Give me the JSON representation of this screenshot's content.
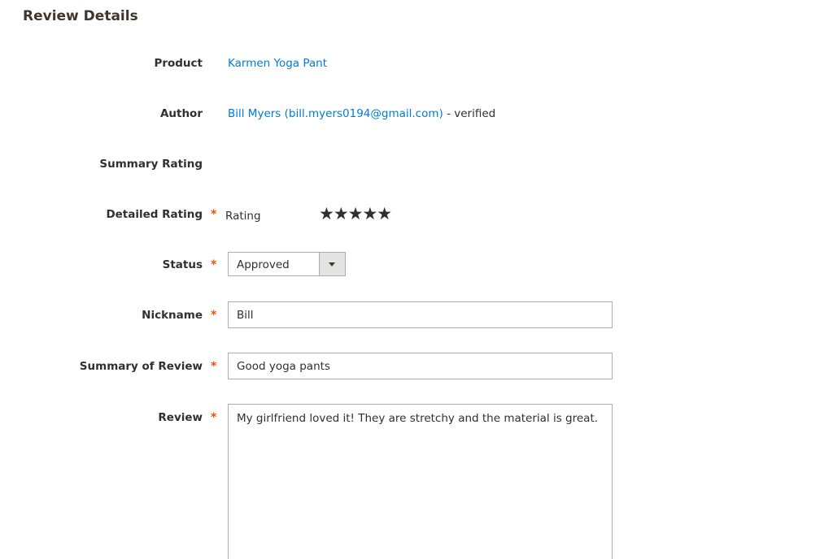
{
  "section": {
    "title": "Review Details"
  },
  "product": {
    "label": "Product",
    "value": "Karmen Yoga Pant"
  },
  "author": {
    "label": "Author",
    "name_link": "Bill Myers (bill.myers0194@gmail.com)",
    "suffix": " - verified"
  },
  "summary_rating": {
    "label": "Summary Rating"
  },
  "detailed_rating": {
    "label": "Detailed Rating",
    "required_mark": "*",
    "rating_label": "Rating",
    "stars": "★★★★★",
    "rating_value": 5,
    "rating_max": 5
  },
  "status": {
    "label": "Status",
    "required_mark": "*",
    "selected": "Approved"
  },
  "nickname": {
    "label": "Nickname",
    "required_mark": "*",
    "value": "Bill"
  },
  "summary_of_review": {
    "label": "Summary of Review",
    "required_mark": "*",
    "value": "Good yoga pants"
  },
  "review": {
    "label": "Review",
    "required_mark": "*",
    "value": "My girlfriend loved it! They are stretchy and the material is great."
  },
  "colors": {
    "link": "#007bdb",
    "required": "#eb5202",
    "text": "#303030",
    "border": "#adadad"
  }
}
